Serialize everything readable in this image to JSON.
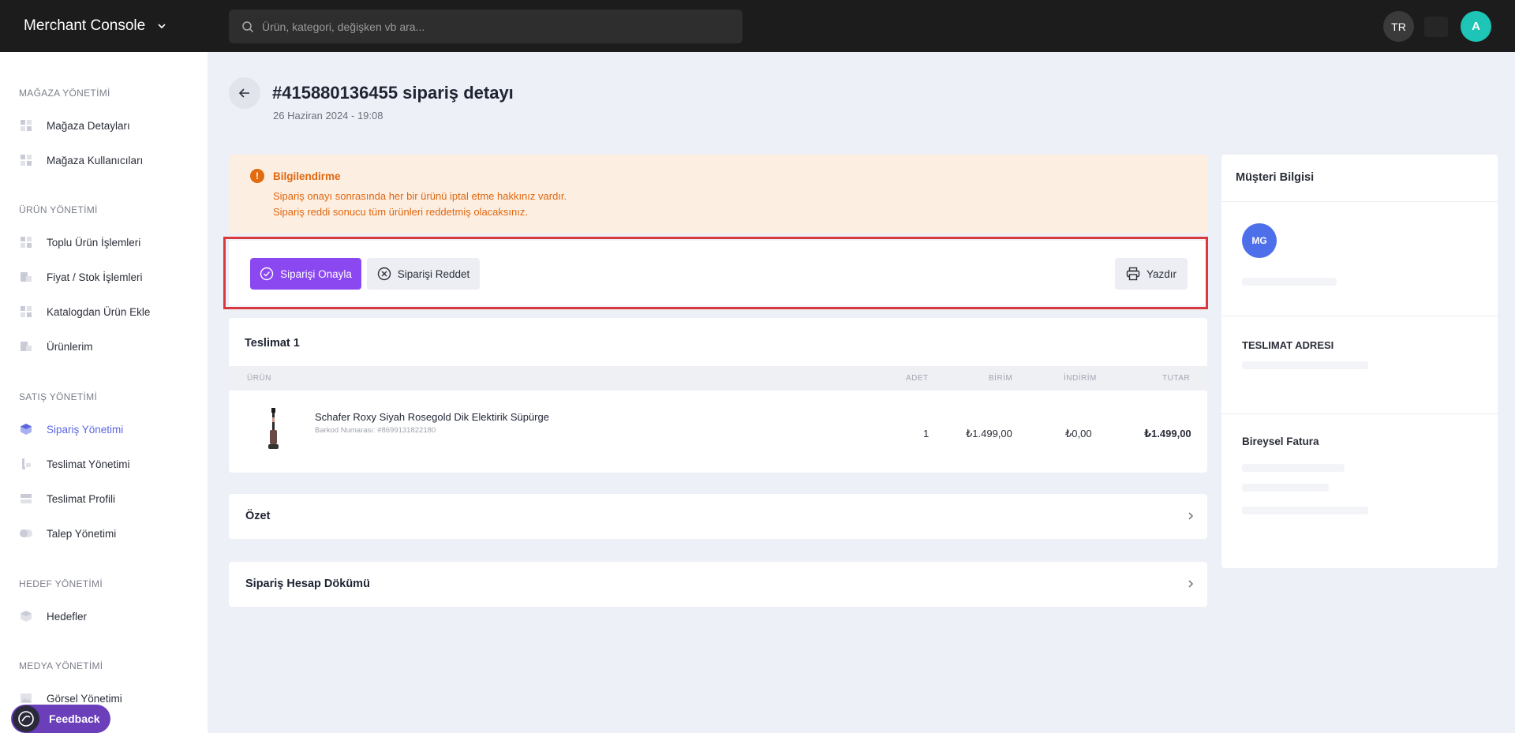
{
  "topbar": {
    "brand": "Merchant Console",
    "search_placeholder": "Ürün, kategori, değişken vb ara...",
    "lang": "TR",
    "user_initial": "A"
  },
  "sidebar": {
    "sections": [
      {
        "title": "MAĞAZA YÖNETİMİ",
        "items": [
          "Mağaza Detayları",
          "Mağaza Kullanıcıları"
        ]
      },
      {
        "title": "ÜRÜN YÖNETİMİ",
        "items": [
          "Toplu Ürün İşlemleri",
          "Fiyat / Stok İşlemleri",
          "Katalogdan Ürün Ekle",
          "Ürünlerim"
        ]
      },
      {
        "title": "SATIŞ YÖNETİMİ",
        "items": [
          "Sipariş Yönetimi",
          "Teslimat Yönetimi",
          "Teslimat Profili",
          "Talep Yönetimi"
        ]
      },
      {
        "title": "HEDEF YÖNETİMİ",
        "items": [
          "Hedefler"
        ]
      },
      {
        "title": "MEDYA YÖNETİMİ",
        "items": [
          "Görsel Yönetimi"
        ]
      }
    ],
    "feedback": "Feedback"
  },
  "page": {
    "title": "#415880136455 sipariş detayı",
    "date": "26 Haziran 2024 - 19:08"
  },
  "alert": {
    "title": "Bilgilendirme",
    "line1": "Sipariş onayı sonrasında her bir ürünü iptal etme hakkınız vardır.",
    "line2": "Sipariş reddi sonucu tüm ürünleri reddetmiş olacaksınız."
  },
  "actions": {
    "approve": "Siparişi Onayla",
    "reject": "Siparişi Reddet",
    "print": "Yazdır"
  },
  "delivery": {
    "title": "Teslimat 1",
    "columns": [
      "ÜRÜN",
      "ADET",
      "BİRİM",
      "İNDİRİM",
      "TUTAR"
    ],
    "rows": [
      {
        "name": "Schafer Roxy Siyah Rosegold Dik Elektirik Süpürge",
        "barcode": "Barkod Numarası: #8699131822180",
        "qty": "1",
        "unit": "₺1.499,00",
        "discount": "₺0,00",
        "total": "₺1.499,00"
      }
    ]
  },
  "summary": {
    "title": "Özet"
  },
  "breakdown": {
    "title": "Sipariş Hesap Dökümü"
  },
  "customer": {
    "title": "Müşteri Bilgisi",
    "initials": "MG",
    "address_title": "TESLIMAT ADRESI",
    "invoice_title": "Bireysel Fatura"
  },
  "colors": {
    "accent": "#8b47f0",
    "active_nav": "#5b66e0",
    "alert_text": "#e0670e",
    "highlight": "#d9393e"
  }
}
